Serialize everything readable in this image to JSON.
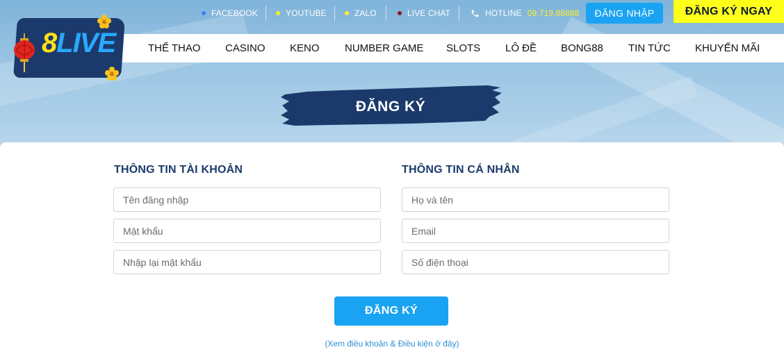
{
  "topbar": {
    "links": [
      {
        "label": "FACEBOOK",
        "dot_color": "#3b82f6"
      },
      {
        "label": "YOUTUBE",
        "dot_color": "#ffef2e"
      },
      {
        "label": "ZALO",
        "dot_color": "#ffef2e"
      },
      {
        "label": "LIVE CHAT",
        "dot_color": "#8b1a1a"
      }
    ],
    "hotline_label": "HOTLINE",
    "hotline_number": "09.719.88888",
    "login_label": "ĐĂNG NHẬP",
    "register_now_label": "ĐĂNG KÝ NGAY"
  },
  "logo": {
    "eight": "8",
    "live": "LIVE"
  },
  "nav": {
    "items": [
      "THỂ THAO",
      "CASINO",
      "KENO",
      "NUMBER GAME",
      "SLOTS",
      "LÔ ĐỀ",
      "BONG88",
      "TIN TỨC",
      "KHUYẾN MÃI"
    ]
  },
  "hero": {
    "title": "ĐĂNG KÝ"
  },
  "form": {
    "account_heading": "THÔNG TIN TÀI KHOẢN",
    "personal_heading": "THÔNG TIN CÁ NHÂN",
    "username_placeholder": "Tên đăng nhập",
    "password_placeholder": "Mật khẩu",
    "confirm_password_placeholder": "Nhập lại mật khẩu",
    "fullname_placeholder": "Họ và tên",
    "email_placeholder": "Email",
    "phone_placeholder": "Số điện thoại",
    "submit_label": "ĐĂNG KÝ",
    "terms_link": "(Xem điều khoản & Điều kiện ở đây)"
  },
  "colors": {
    "brand_navy": "#1b3a6b",
    "accent_blue": "#1aa3f2",
    "accent_yellow": "#ffff1a"
  }
}
